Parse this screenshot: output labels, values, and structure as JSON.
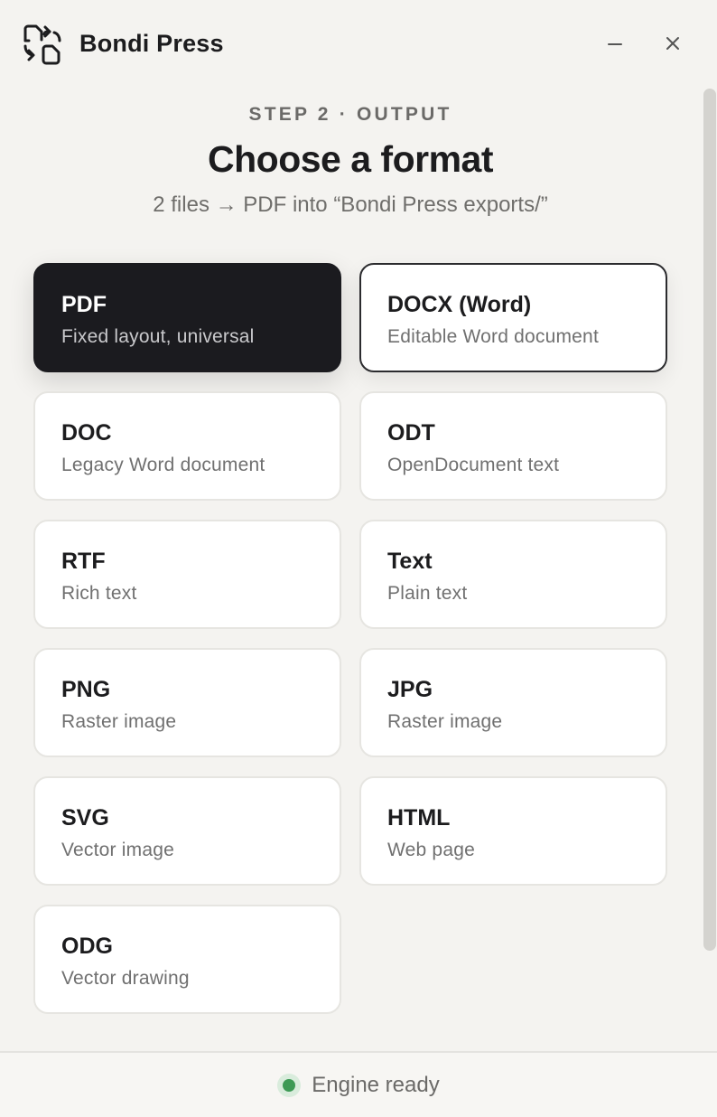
{
  "app": {
    "name": "Bondi Press",
    "icon": "convert-files-icon"
  },
  "window_controls": {
    "minimize_icon": "minimize-icon",
    "close_icon": "close-icon"
  },
  "header": {
    "step": "STEP 2 · OUTPUT",
    "title": "Choose a format",
    "subtitle": "2 files → PDF into “Bondi Press exports/”"
  },
  "formats": [
    {
      "id": "pdf",
      "name": "PDF",
      "desc": "Fixed layout, universal",
      "selected": true
    },
    {
      "id": "docx",
      "name": "DOCX (Word)",
      "desc": "Editable Word document",
      "focused": true
    },
    {
      "id": "doc",
      "name": "DOC",
      "desc": "Legacy Word document"
    },
    {
      "id": "odt",
      "name": "ODT",
      "desc": "OpenDocument text"
    },
    {
      "id": "rtf",
      "name": "RTF",
      "desc": "Rich text"
    },
    {
      "id": "text",
      "name": "Text",
      "desc": "Plain text"
    },
    {
      "id": "png",
      "name": "PNG",
      "desc": "Raster image"
    },
    {
      "id": "jpg",
      "name": "JPG",
      "desc": "Raster image"
    },
    {
      "id": "svg",
      "name": "SVG",
      "desc": "Vector image"
    },
    {
      "id": "html",
      "name": "HTML",
      "desc": "Web page"
    },
    {
      "id": "odg",
      "name": "ODG",
      "desc": "Vector drawing"
    }
  ],
  "footer": {
    "status_text": "Engine ready",
    "status_color": "#3e9a55"
  },
  "colors": {
    "background": "#f4f3f0",
    "selected_card": "#1b1b1f",
    "card": "#ffffff"
  }
}
